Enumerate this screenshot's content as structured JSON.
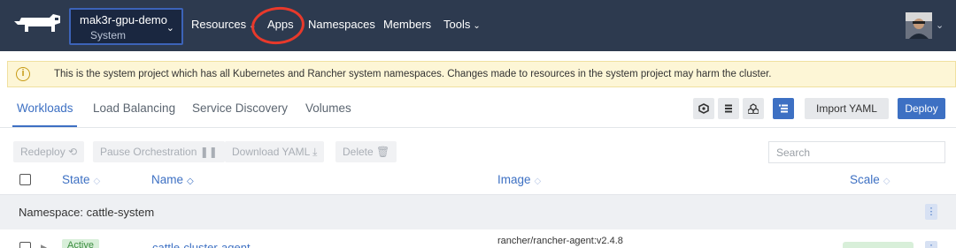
{
  "header": {
    "cluster": {
      "name": "mak3r-gpu-demo",
      "sub": "System"
    },
    "nav": [
      {
        "label": "Resources",
        "dropdown": true
      },
      {
        "label": "Apps",
        "dropdown": false
      },
      {
        "label": "Namespaces",
        "dropdown": false
      },
      {
        "label": "Members",
        "dropdown": false
      },
      {
        "label": "Tools",
        "dropdown": true
      }
    ],
    "caret_glyph": "⌄"
  },
  "banner": {
    "icon": "info-circle-icon",
    "icon_glyph": "i",
    "text": "This is the system project which has all Kubernetes and Rancher system namespaces. Changes made to resources in the system project may harm the cluster."
  },
  "tabs": [
    {
      "label": "Workloads",
      "active": true
    },
    {
      "label": "Load Balancing",
      "active": false
    },
    {
      "label": "Service Discovery",
      "active": false
    },
    {
      "label": "Volumes",
      "active": false
    }
  ],
  "toolbar": {
    "view_icons": [
      "node-view-icon",
      "list-view-icon",
      "group-view-icon",
      "namespace-view-icon"
    ],
    "import_label": "Import YAML",
    "deploy_label": "Deploy"
  },
  "bulk_actions": [
    {
      "label": "Redeploy",
      "icon": "⟲"
    },
    {
      "label": "Pause Orchestration",
      "icon": "❚❚"
    },
    {
      "label": "Download YAML",
      "icon": "⤓"
    },
    {
      "label": "Delete",
      "icon": "🗑"
    }
  ],
  "search": {
    "placeholder": "Search",
    "value": ""
  },
  "table": {
    "columns": [
      "State",
      "Name",
      "Image",
      "Scale"
    ],
    "sort_glyph": "◇",
    "groups": [
      {
        "label": "Namespace: cattle-system",
        "rows": [
          {
            "state": "Active",
            "name": "cattle-cluster-agent",
            "image": "rancher/rancher-agent:v2.4.8"
          }
        ]
      }
    ]
  },
  "colors": {
    "topbar": "#2d3a4f",
    "accent": "#3d70c3",
    "warning_bg": "#fdf6d6",
    "annotation": "#e8392b",
    "active_green": "#d8efd9"
  }
}
